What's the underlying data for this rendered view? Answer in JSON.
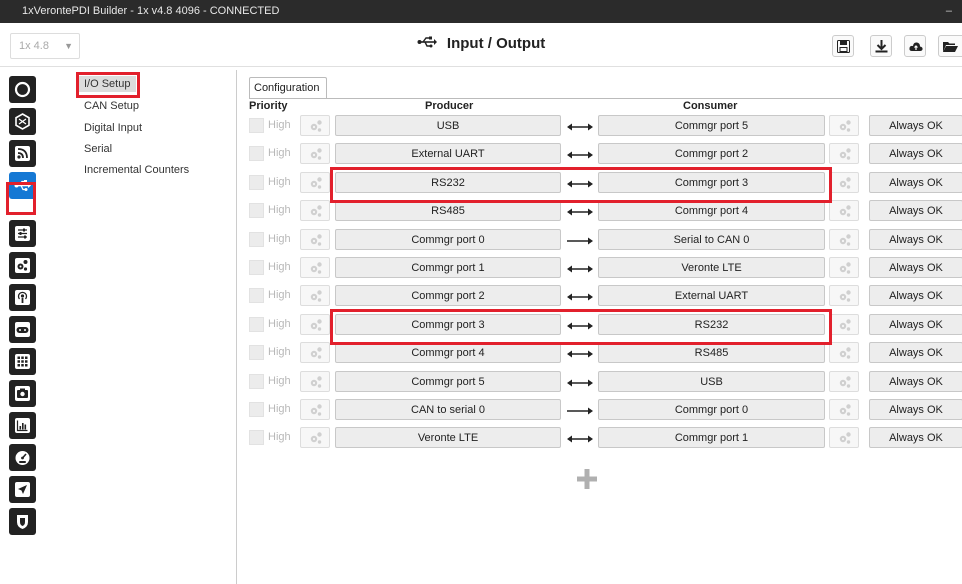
{
  "window": {
    "title": "1xVerontePDI Builder - 1x v4.8 4096 - CONNECTED",
    "minimize": "–"
  },
  "header": {
    "version_select": "1x 4.8",
    "title_icon": "usb-icon",
    "title": "Input / Output",
    "buttons": [
      "save-icon",
      "download-icon",
      "cloud-upload-icon",
      "folder-open-icon"
    ]
  },
  "leftbar": {
    "icons": [
      "power-icon",
      "hexagon-icon",
      "radio-icon",
      "usb-icon",
      "sliders-icon",
      "cogs-icon",
      "podcast-icon",
      "gamepad-icon",
      "grid-icon",
      "camera-icon",
      "chart-icon",
      "gauge-icon",
      "plane-icon",
      "shield-icon"
    ],
    "active": "usb-icon"
  },
  "nav": {
    "items": [
      "I/O Setup",
      "CAN Setup",
      "Digital Input",
      "Serial",
      "Incremental Counters"
    ],
    "active": "I/O Setup"
  },
  "main": {
    "tab": "Configuration",
    "columns": {
      "priority": "Priority",
      "producer": "Producer",
      "consumer": "Consumer"
    },
    "high_label": "High",
    "rows": [
      {
        "producer": "USB",
        "consumer": "Commgr port 5",
        "status": "Always OK",
        "direction": "both"
      },
      {
        "producer": "External UART",
        "consumer": "Commgr port 2",
        "status": "Always OK",
        "direction": "both"
      },
      {
        "producer": "RS232",
        "consumer": "Commgr port 3",
        "status": "Always OK",
        "direction": "both"
      },
      {
        "producer": "RS485",
        "consumer": "Commgr port 4",
        "status": "Always OK",
        "direction": "both"
      },
      {
        "producer": "Commgr port 0",
        "consumer": "Serial to CAN 0",
        "status": "Always OK",
        "direction": "right"
      },
      {
        "producer": "Commgr port 1",
        "consumer": "Veronte LTE",
        "status": "Always OK",
        "direction": "both"
      },
      {
        "producer": "Commgr port 2",
        "consumer": "External UART",
        "status": "Always OK",
        "direction": "both"
      },
      {
        "producer": "Commgr port 3",
        "consumer": "RS232",
        "status": "Always OK",
        "direction": "both"
      },
      {
        "producer": "Commgr port 4",
        "consumer": "RS485",
        "status": "Always OK",
        "direction": "both"
      },
      {
        "producer": "Commgr port 5",
        "consumer": "USB",
        "status": "Always OK",
        "direction": "both"
      },
      {
        "producer": "CAN to serial 0",
        "consumer": "Commgr port 0",
        "status": "Always OK",
        "direction": "right"
      },
      {
        "producer": "Veronte LTE",
        "consumer": "Commgr port 1",
        "status": "Always OK",
        "direction": "both"
      }
    ],
    "highlighted_rows": [
      2,
      7
    ],
    "add_button": "plus-icon"
  },
  "colors": {
    "accent": "#1578d4",
    "highlight": "#e2202c",
    "titlebar": "#2b2b2b"
  }
}
